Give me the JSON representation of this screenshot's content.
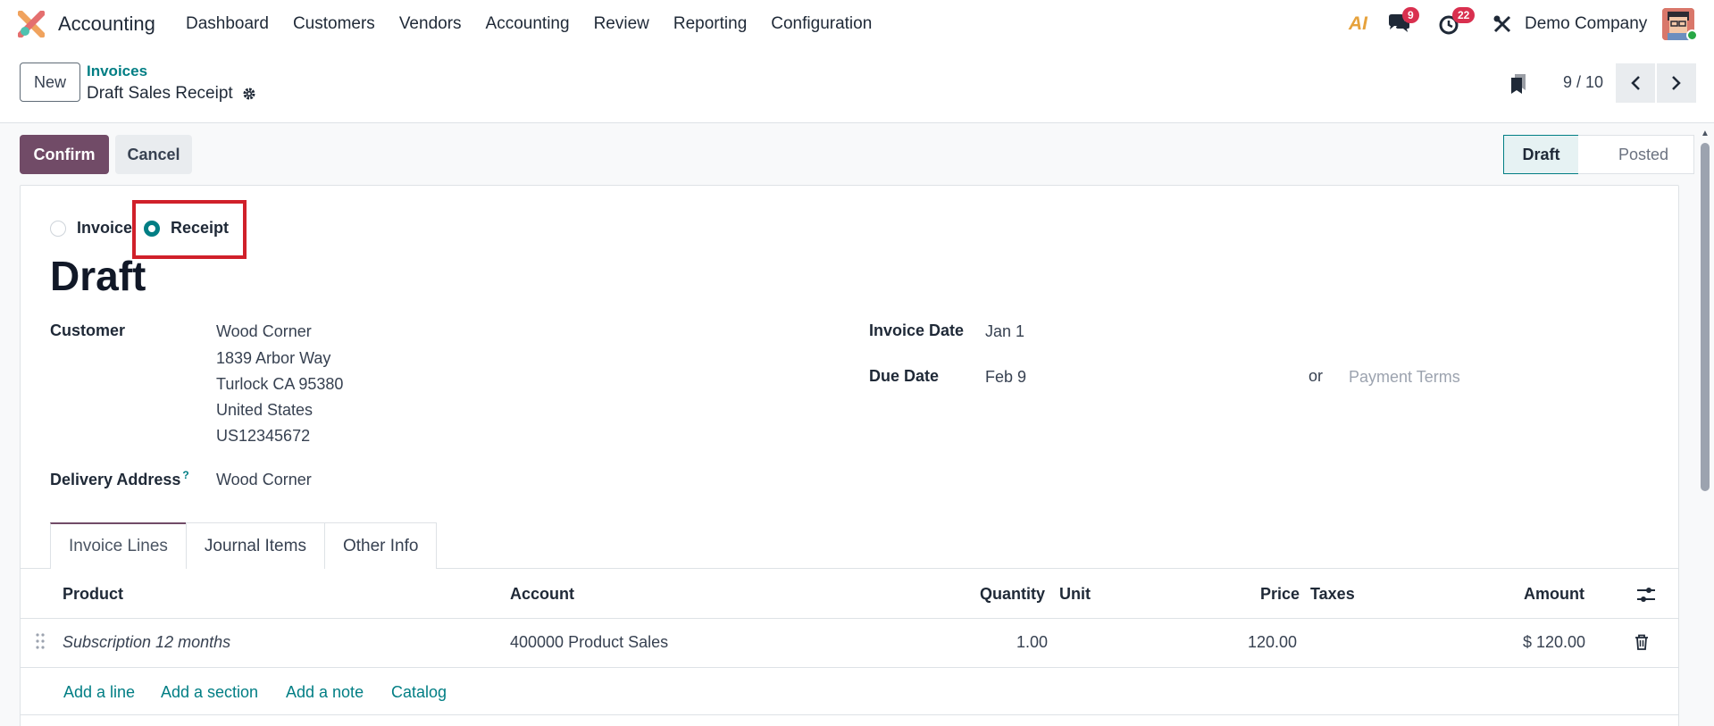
{
  "navbar": {
    "app_name": "Accounting",
    "menu": [
      "Dashboard",
      "Customers",
      "Vendors",
      "Accounting",
      "Review",
      "Reporting",
      "Configuration"
    ],
    "ai_label": "AI",
    "messages_badge": "9",
    "activities_badge": "22",
    "company": "Demo Company"
  },
  "control_panel": {
    "new_label": "New",
    "breadcrumb_parent": "Invoices",
    "breadcrumb_current": "Draft Sales Receipt",
    "pager_value": "9 / 10"
  },
  "actions": {
    "confirm_label": "Confirm",
    "cancel_label": "Cancel"
  },
  "statusbar": {
    "draft": "Draft",
    "posted": "Posted"
  },
  "form": {
    "type_invoice": "Invoice",
    "type_receipt": "Receipt",
    "title": "Draft",
    "customer_label": "Customer",
    "customer_lines": [
      "Wood Corner",
      "1839 Arbor Way",
      "Turlock CA 95380",
      "United States",
      "US12345672"
    ],
    "delivery_label": "Delivery Address",
    "delivery_help": "?",
    "delivery_value": "Wood Corner",
    "invoice_date_label": "Invoice Date",
    "invoice_date_value": "Jan 1",
    "due_date_label": "Due Date",
    "due_date_value": "Feb 9",
    "or_text": "or",
    "payment_terms_placeholder": "Payment Terms"
  },
  "tabs": [
    "Invoice Lines",
    "Journal Items",
    "Other Info"
  ],
  "table": {
    "headers": {
      "product": "Product",
      "account": "Account",
      "quantity": "Quantity",
      "unit": "Unit",
      "price": "Price",
      "taxes": "Taxes",
      "amount": "Amount"
    },
    "rows": [
      {
        "product": "Subscription 12 months",
        "account": "400000 Product Sales",
        "quantity": "1.00",
        "unit": "",
        "price": "120.00",
        "taxes": "",
        "amount": "$ 120.00"
      }
    ],
    "add_links": [
      "Add a line",
      "Add a section",
      "Add a note",
      "Catalog"
    ]
  },
  "colors": {
    "brand": "#714b67",
    "accent": "#017e84",
    "badge": "#d9304f",
    "highlight": "#d0202a"
  }
}
